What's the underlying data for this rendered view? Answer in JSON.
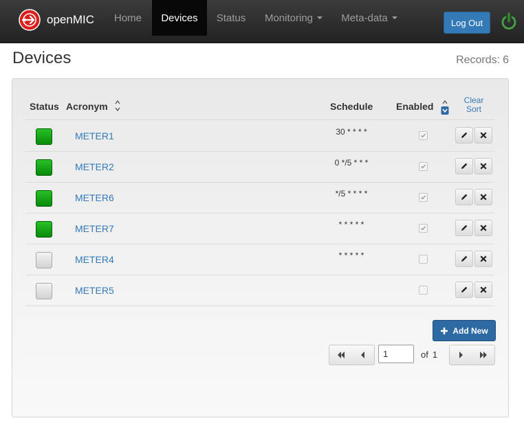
{
  "navbar": {
    "brand": "openMIC",
    "items": [
      {
        "label": "Home"
      },
      {
        "label": "Devices",
        "active": true
      },
      {
        "label": "Status"
      },
      {
        "label": "Monitoring",
        "dropdown": true
      },
      {
        "label": "Meta-data",
        "dropdown": true
      }
    ],
    "logout_label": "Log Out"
  },
  "page": {
    "title": "Devices",
    "records_label": "Records:",
    "records_count": "6"
  },
  "table": {
    "headers": {
      "status": "Status",
      "acronym": "Acronym",
      "schedule": "Schedule",
      "enabled": "Enabled",
      "clear_sort": "Clear Sort"
    },
    "rows": [
      {
        "status": "online",
        "acronym": "METER1",
        "schedule": "30 * * * *",
        "enabled": true
      },
      {
        "status": "online",
        "acronym": "METER2",
        "schedule": "0 */5 * * *",
        "enabled": true
      },
      {
        "status": "online",
        "acronym": "METER6",
        "schedule": "*/5 * * * *",
        "enabled": true
      },
      {
        "status": "online",
        "acronym": "METER7",
        "schedule": "* * * * *",
        "enabled": true
      },
      {
        "status": "offline",
        "acronym": "METER4",
        "schedule": "* * * * *",
        "enabled": false
      },
      {
        "status": "offline",
        "acronym": "METER5",
        "schedule": "",
        "enabled": false
      }
    ]
  },
  "actions": {
    "add_new_label": "Add New"
  },
  "pagination": {
    "current_page": "1",
    "of_label": "of",
    "total_pages": "1"
  },
  "colors": {
    "navbar": "#222222",
    "accent": "#337ab7",
    "status_on": "#1aa51a",
    "status_off": "#dddddd"
  },
  "icons": {
    "brand": "openmic-logo-icon",
    "power": "power-icon",
    "edit": "pencil-icon",
    "delete": "close-icon",
    "add": "plus-icon",
    "first": "first-page-icon",
    "prev": "prev-page-icon",
    "next": "next-page-icon",
    "last": "last-page-icon"
  }
}
